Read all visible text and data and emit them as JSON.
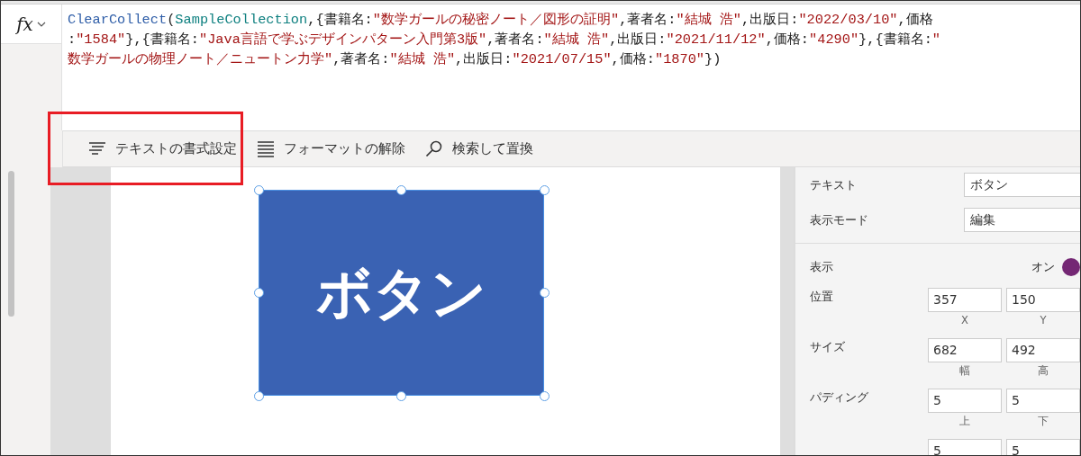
{
  "formula_bar": {
    "fx_label": "fx",
    "lines": [
      [
        {
          "kind": "function",
          "text": "ClearCollect"
        },
        {
          "kind": "plain",
          "text": "("
        },
        {
          "kind": "name",
          "text": "SampleCollection"
        },
        {
          "kind": "plain",
          "text": ",{書籍名:"
        },
        {
          "kind": "string",
          "text": "\"数学ガールの秘密ノート／図形の証明\""
        },
        {
          "kind": "plain",
          "text": ",著者名:"
        },
        {
          "kind": "string",
          "text": "\"結城 浩\""
        },
        {
          "kind": "plain",
          "text": ",出版日:"
        },
        {
          "kind": "string",
          "text": "\"2022/03/10\""
        },
        {
          "kind": "plain",
          "text": ",価格"
        }
      ],
      [
        {
          "kind": "plain",
          "text": ":"
        },
        {
          "kind": "string",
          "text": "\"1584\""
        },
        {
          "kind": "plain",
          "text": "},{書籍名:"
        },
        {
          "kind": "string",
          "text": "\"Java言語で学ぶデザインパターン入門第3版\""
        },
        {
          "kind": "plain",
          "text": ",著者名:"
        },
        {
          "kind": "string",
          "text": "\"結城 浩\""
        },
        {
          "kind": "plain",
          "text": ",出版日:"
        },
        {
          "kind": "string",
          "text": "\"2021/11/12\""
        },
        {
          "kind": "plain",
          "text": ",価格:"
        },
        {
          "kind": "string",
          "text": "\"4290\""
        },
        {
          "kind": "plain",
          "text": "},{書籍名:"
        },
        {
          "kind": "string",
          "text": "\""
        }
      ],
      [
        {
          "kind": "string",
          "text": "数学ガールの物理ノート／ニュートン力学\""
        },
        {
          "kind": "plain",
          "text": ",著者名:"
        },
        {
          "kind": "string",
          "text": "\"結城 浩\""
        },
        {
          "kind": "plain",
          "text": ",出版日:"
        },
        {
          "kind": "string",
          "text": "\"2021/07/15\""
        },
        {
          "kind": "plain",
          "text": ",価格:"
        },
        {
          "kind": "string",
          "text": "\"1870\""
        },
        {
          "kind": "plain",
          "text": "})"
        }
      ]
    ]
  },
  "toolbar": [
    {
      "kind": "format",
      "label": "テキストの書式設定",
      "highlighted": true
    },
    {
      "kind": "clear",
      "label": "フォーマットの解除",
      "highlighted": false
    },
    {
      "kind": "search",
      "label": "検索して置換",
      "highlighted": false
    }
  ],
  "canvas": {
    "button_text": "ボタン",
    "selected": true
  },
  "properties": [
    {
      "kind": "text",
      "label": "テキスト",
      "value": "ボタン"
    },
    {
      "kind": "text",
      "label": "表示モード",
      "value": "編集"
    },
    {
      "kind": "divider"
    },
    {
      "kind": "toggle",
      "label": "表示",
      "state_label": "オン",
      "on": true
    },
    {
      "kind": "pair",
      "label": "位置",
      "values": [
        "357",
        "150"
      ],
      "captions": [
        "X",
        "Y"
      ]
    },
    {
      "kind": "pair",
      "label": "サイズ",
      "values": [
        "682",
        "492"
      ],
      "captions": [
        "幅",
        "高"
      ]
    },
    {
      "kind": "pair",
      "label": "パディング",
      "values": [
        "5",
        "5"
      ],
      "captions": [
        "上",
        "下"
      ]
    },
    {
      "kind": "pair",
      "values": [
        "5",
        "5"
      ]
    }
  ]
}
